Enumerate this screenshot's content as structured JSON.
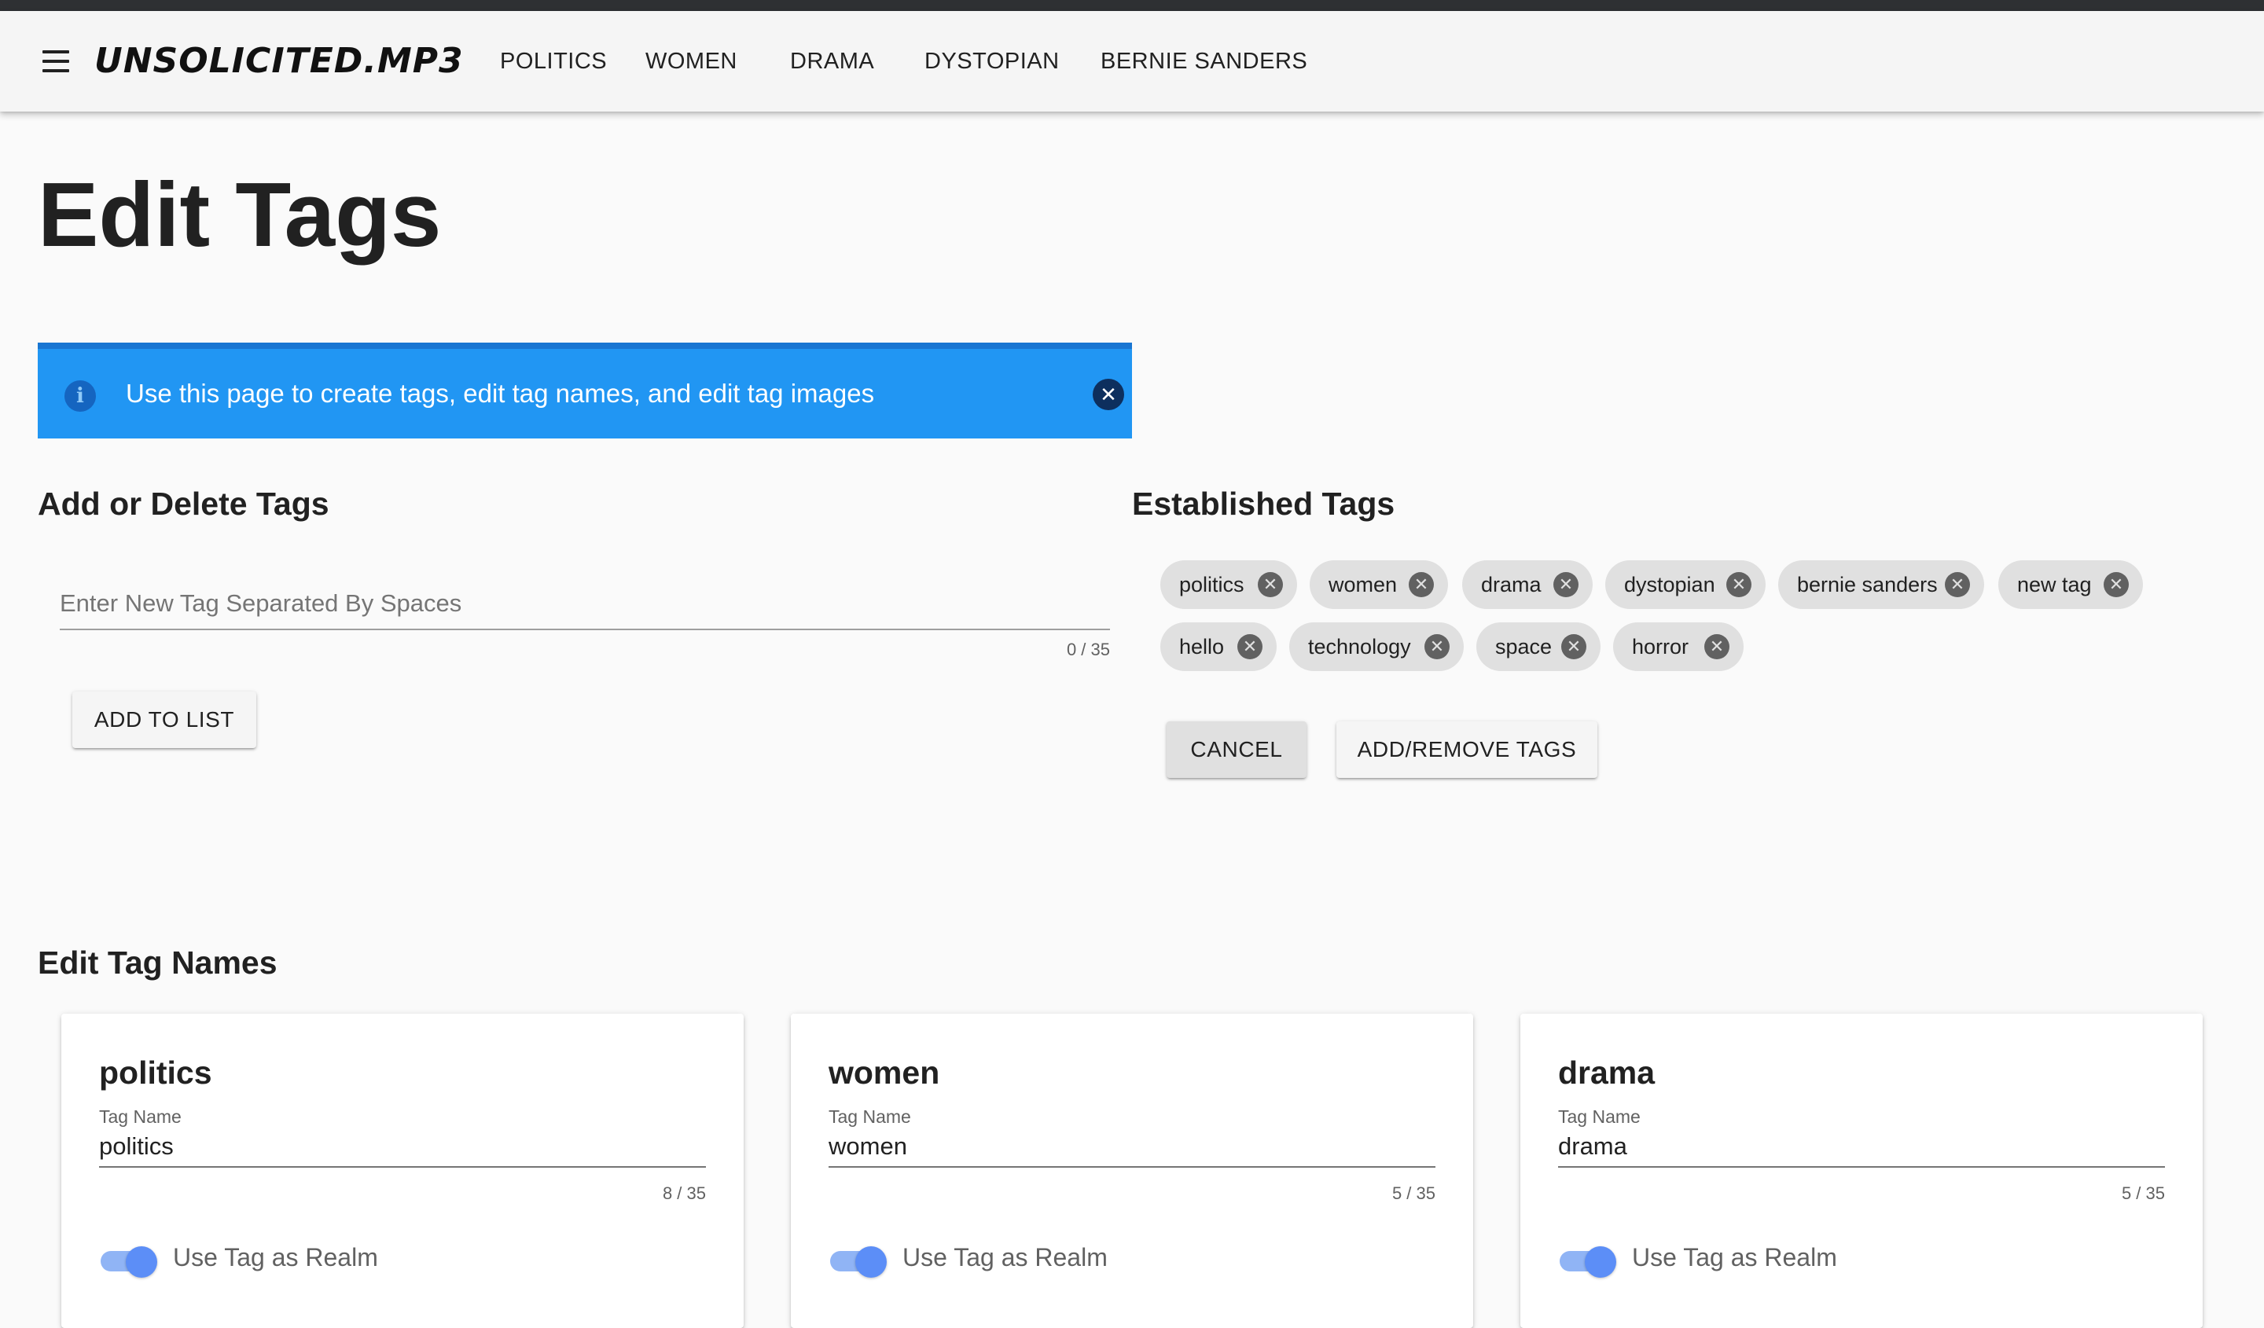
{
  "header": {
    "logo": "UNSOLICITED.MP3",
    "nav": [
      "POLITICS",
      "WOMEN",
      "DRAMA",
      "DYSTOPIAN",
      "BERNIE SANDERS"
    ]
  },
  "page": {
    "title": "Edit Tags"
  },
  "alert": {
    "message": "Use this page to create tags, edit tag names, and edit tag images",
    "info_icon": "info-icon",
    "close_icon": "close-icon",
    "color": "#2196f3"
  },
  "add_delete": {
    "title": "Add or Delete Tags",
    "placeholder": "Enter New Tag Separated By Spaces",
    "value": "",
    "counter": "0 / 35",
    "button": "ADD TO LIST"
  },
  "established": {
    "title": "Established Tags",
    "chips": [
      "politics",
      "women",
      "drama",
      "dystopian",
      "bernie sanders",
      "new tag",
      "hello",
      "technology",
      "space",
      "horror"
    ],
    "cancel": "CANCEL",
    "submit": "ADD/REMOVE TAGS"
  },
  "edit_names": {
    "title": "Edit Tag Names",
    "cards": [
      {
        "title": "politics",
        "label": "Tag Name",
        "value": "politics",
        "counter": "8 / 35",
        "switch_label": "Use Tag as Realm",
        "switch_on": true
      },
      {
        "title": "women",
        "label": "Tag Name",
        "value": "women",
        "counter": "5 / 35",
        "switch_label": "Use Tag as Realm",
        "switch_on": true
      },
      {
        "title": "drama",
        "label": "Tag Name",
        "value": "drama",
        "counter": "5 / 35",
        "switch_label": "Use Tag as Realm",
        "switch_on": true
      }
    ]
  },
  "colors": {
    "accent_switch": "#5c8ef7",
    "appbar": "#f5f5f5",
    "chip": "#e0e0e0"
  }
}
